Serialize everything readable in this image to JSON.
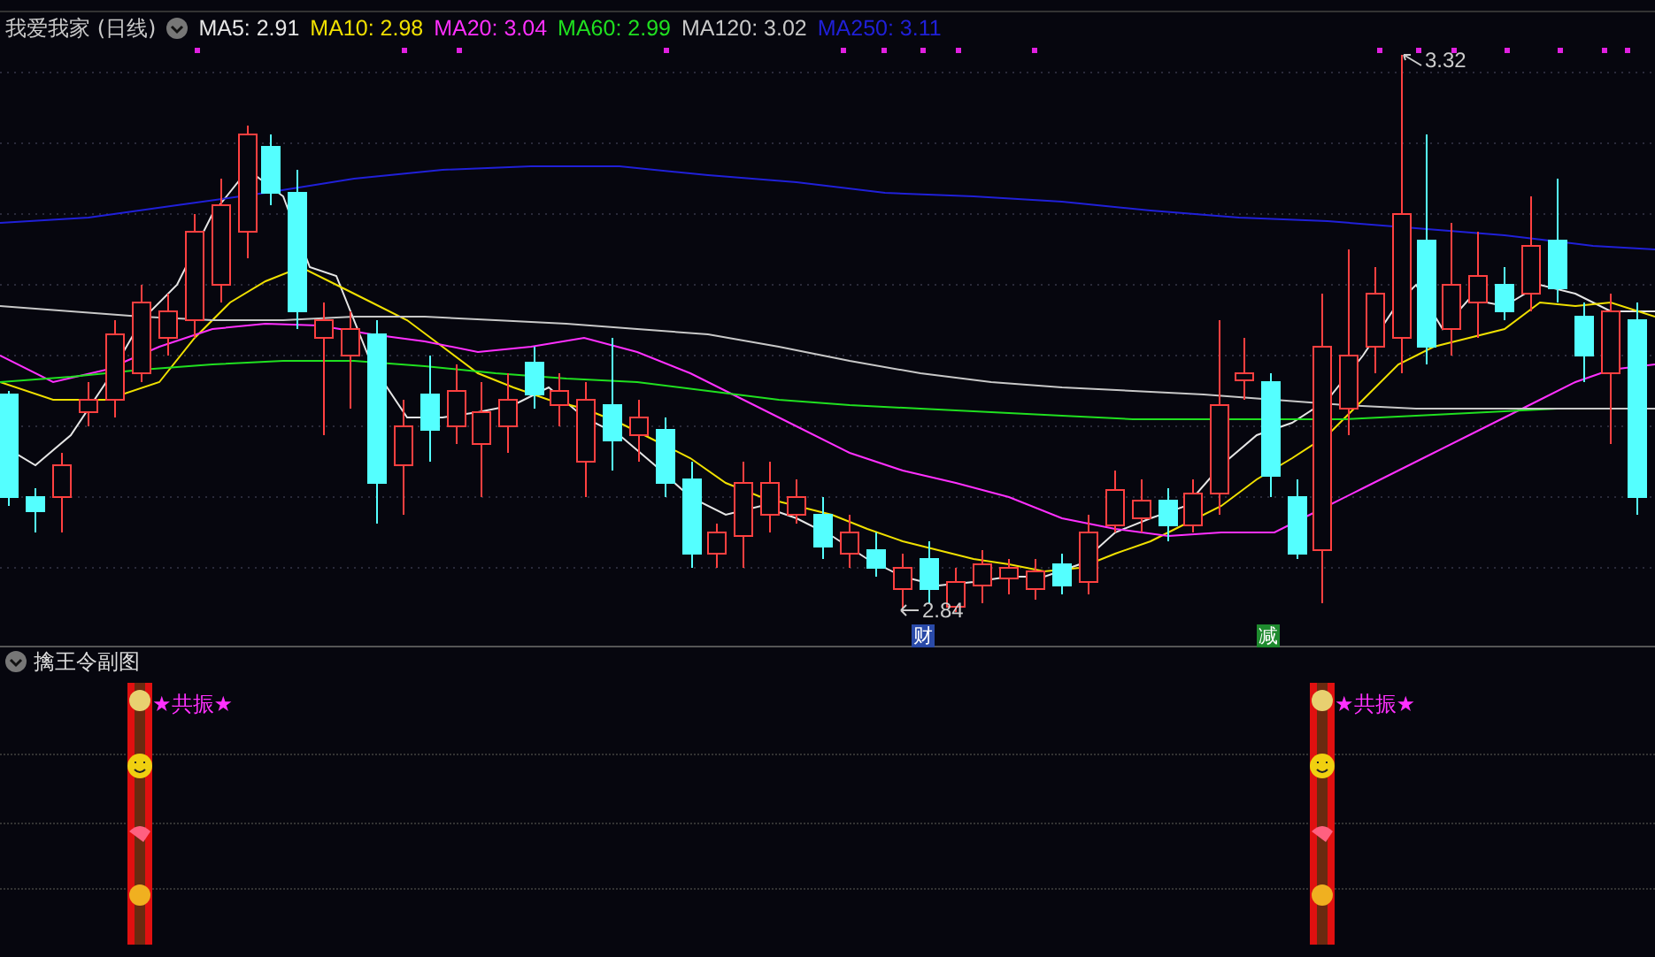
{
  "header": {
    "title": "我爱我家 (日线)",
    "indicators": [
      {
        "label": "MA5: 2.91",
        "color": "#e6e6e6"
      },
      {
        "label": "MA10: 2.98",
        "color": "#f0e000"
      },
      {
        "label": "MA20: 3.04",
        "color": "#ff30ff"
      },
      {
        "label": "MA60: 2.99",
        "color": "#20e020"
      },
      {
        "label": "MA120: 3.02",
        "color": "#c8c8c8"
      },
      {
        "label": "MA250: 3.11",
        "color": "#2020d8"
      }
    ]
  },
  "chart": {
    "price_labels": [
      {
        "kind": "high",
        "text": "3.32"
      },
      {
        "kind": "low",
        "text": "2.84"
      }
    ],
    "signals": [
      {
        "text": "财",
        "color": "#2a4aa8"
      },
      {
        "text": "减",
        "color": "#1e8a2e"
      }
    ]
  },
  "sub_panel": {
    "title": "擒王令副图",
    "resonance_labels": [
      "★共振★",
      "★共振★"
    ]
  }
}
